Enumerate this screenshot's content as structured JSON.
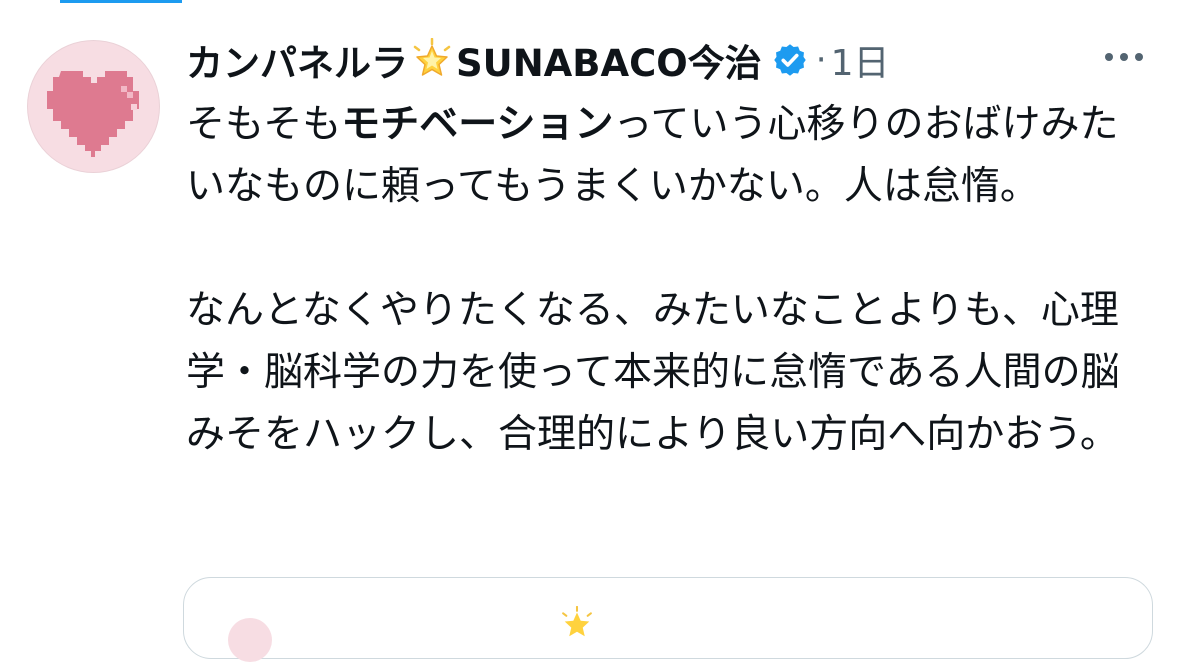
{
  "tweet": {
    "author_name": "カンパネルラ",
    "author_org": "SUNABACO今治",
    "name_emoji": "glowing-star-icon",
    "verified": "verified-badge-icon",
    "separator": "·",
    "timestamp": "1日",
    "more_icon": "more-options-icon",
    "text_p1_a": "そもそも",
    "text_p1_bold": "モチベーション",
    "text_p1_b": "っていう心移りのおばけみたいなものに頼ってもうまくいかない。人は怠惰。",
    "text_p2": "なんとなくやりたくなる、みたいなことよりも、心理学・脳科学の力を使って本来的に怠惰である人間の脳みそをハックし、合理的により良い方向へ向かおう。"
  },
  "colors": {
    "accent": "#1d9bf0",
    "secondary_text": "#536471",
    "avatar_bg": "#f7dde3",
    "heart": "#df7a90"
  }
}
